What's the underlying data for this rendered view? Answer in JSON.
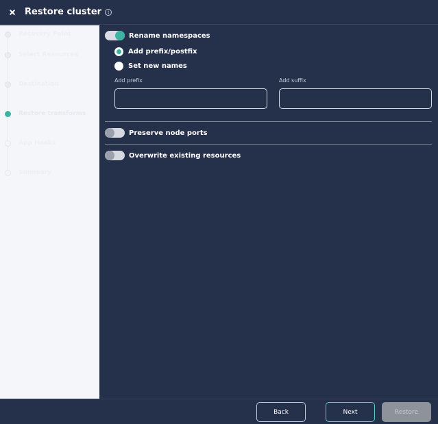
{
  "header": {
    "title": "Restore cluster",
    "info_glyph": "i"
  },
  "sidebar": {
    "steps": [
      {
        "label": "Recovery Point",
        "state": "done"
      },
      {
        "label": "Select Resources",
        "state": "done"
      },
      {
        "label": "Destination",
        "state": "done"
      },
      {
        "label": "Restore transforms",
        "state": "active"
      },
      {
        "label": "App Hooks",
        "state": "pending"
      },
      {
        "label": "Summary",
        "state": "pending"
      }
    ]
  },
  "content": {
    "rename_namespaces": {
      "label": "Rename namespaces",
      "enabled": true
    },
    "rename_options": [
      {
        "label": "Add prefix/postfix",
        "checked": true
      },
      {
        "label": "Set new names",
        "checked": false
      }
    ],
    "prefix": {
      "label": "Add prefix",
      "value": ""
    },
    "suffix": {
      "label": "Add suffix",
      "value": ""
    },
    "preserve_node_ports": {
      "label": "Preserve node ports",
      "enabled": false
    },
    "overwrite_existing": {
      "label": "Overwrite existing resources",
      "enabled": false
    }
  },
  "footer": {
    "back_label": "Back",
    "next_label": "Next",
    "restore_label": "Restore"
  },
  "colors": {
    "background": "#25304b",
    "accent": "#3cb3a3",
    "sidebar": "#f4f6fa"
  }
}
